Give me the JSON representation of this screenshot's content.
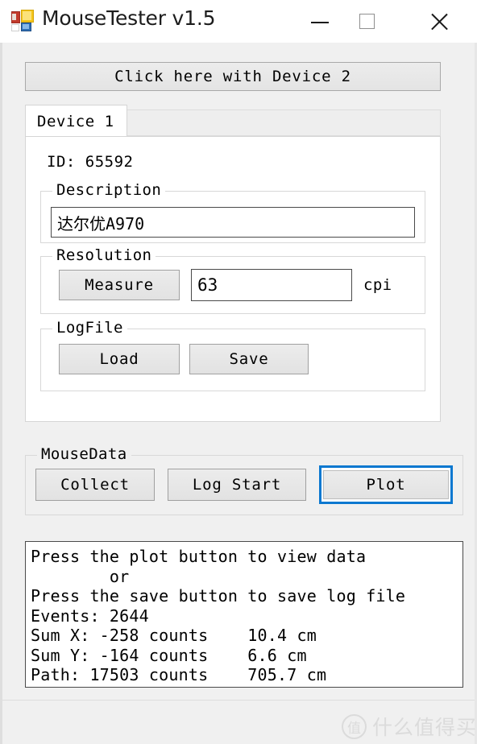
{
  "window": {
    "title": "MouseTester v1.5",
    "icon": "app-grid-icon",
    "controls": {
      "minimize": "minimize-icon",
      "maximize": "maximize-icon",
      "close": "close-icon"
    }
  },
  "device2_button": {
    "label": "Click here with Device 2"
  },
  "tab": {
    "active_label": "Device 1"
  },
  "device1": {
    "id_line": "ID: 65592",
    "description": {
      "group_title": "Description",
      "value": "达尔优A970"
    },
    "resolution": {
      "group_title": "Resolution",
      "measure_label": "Measure",
      "value": "63",
      "unit": "cpi"
    },
    "logfile": {
      "group_title": "LogFile",
      "load_label": "Load",
      "save_label": "Save"
    }
  },
  "mousedata": {
    "group_title": "MouseData",
    "collect_label": "Collect",
    "log_start_label": "Log Start",
    "plot_label": "Plot",
    "focus_color": "#0b78d0"
  },
  "output": {
    "lines": [
      "Press the plot button to view data",
      "        or",
      "Press the save button to save log file",
      "Events: 2644",
      "Sum X: -258 counts    10.4 cm",
      "Sum Y: -164 counts    6.6 cm",
      "Path: 17503 counts    705.7 cm"
    ],
    "line0": "Press the plot button to view data",
    "line1": "        or",
    "line2": "Press the save button to save log file",
    "line3": "Events: 2644",
    "line4": "Sum X: -258 counts    10.4 cm",
    "line5": "Sum Y: -164 counts    6.6 cm",
    "line6": "Path: 17503 counts    705.7 cm"
  },
  "watermark": {
    "badge": "值",
    "text": "什么值得买"
  }
}
